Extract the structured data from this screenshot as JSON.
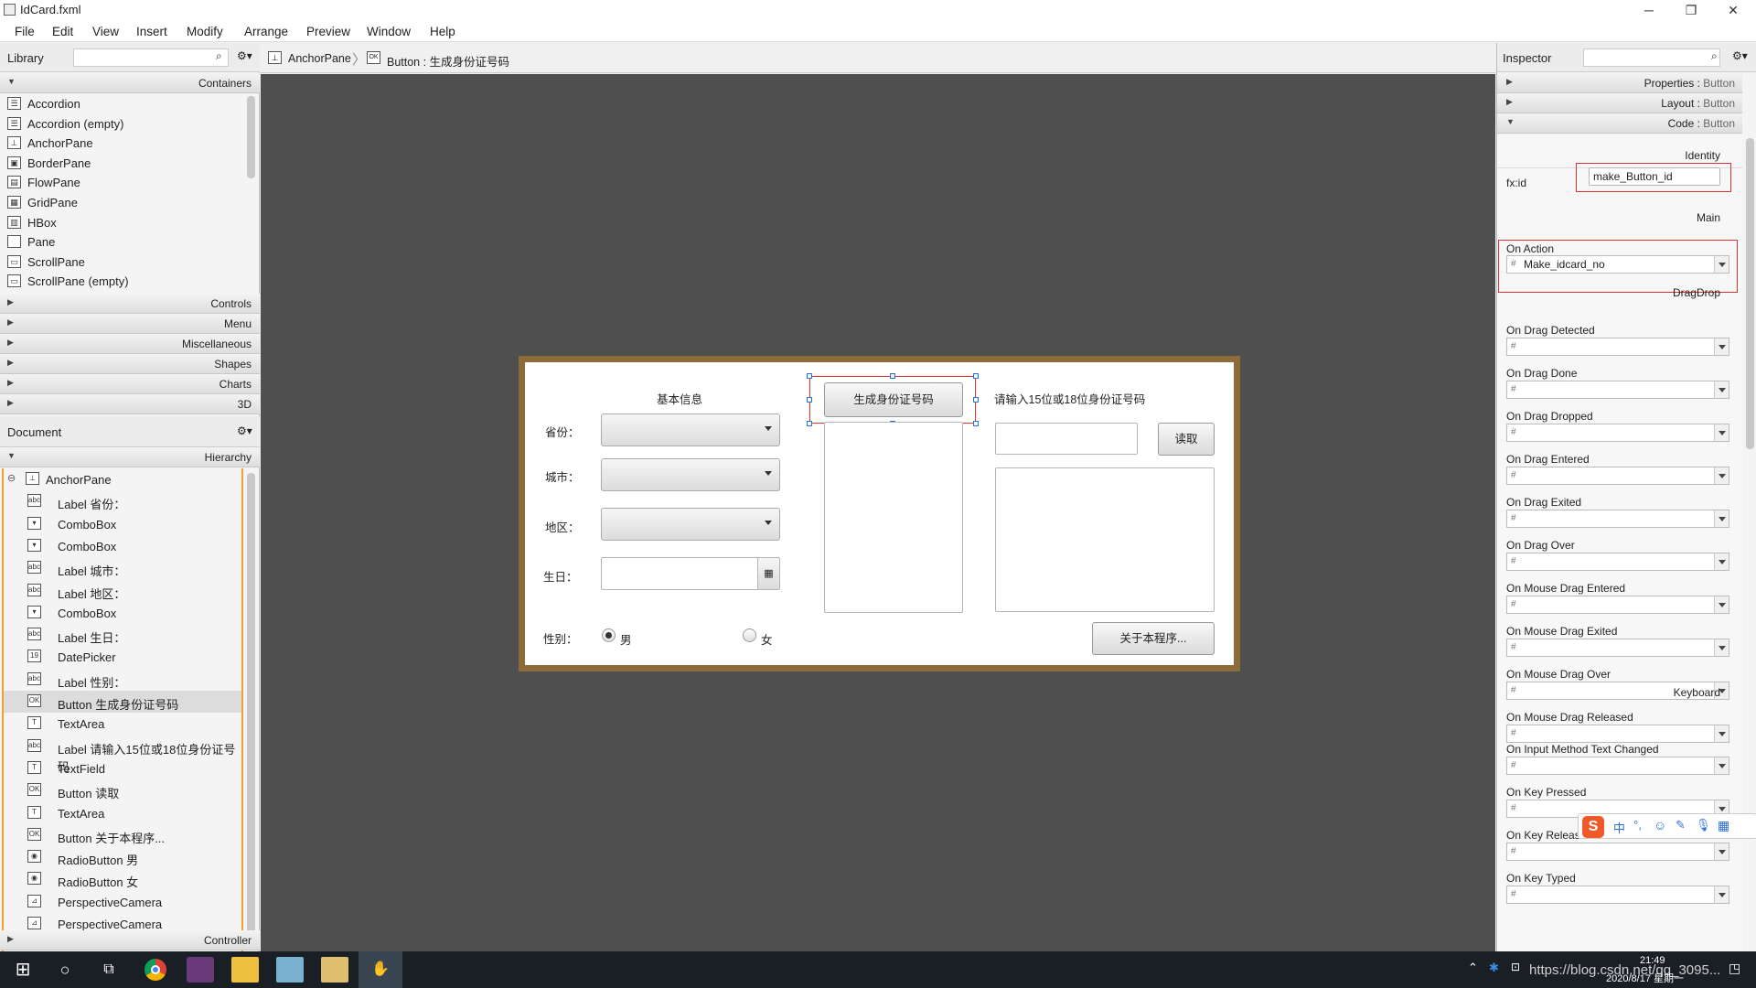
{
  "window": {
    "title": "IdCard.fxml"
  },
  "menu": [
    "File",
    "Edit",
    "View",
    "Insert",
    "Modify",
    "Arrange",
    "Preview",
    "Window",
    "Help"
  ],
  "library": {
    "title": "Library",
    "sections": {
      "containers": "Containers",
      "controls": "Controls",
      "menu": "Menu",
      "misc": "Miscellaneous",
      "shapes": "Shapes",
      "charts": "Charts",
      "three_d": "3D"
    },
    "items": [
      "Accordion",
      "Accordion  (empty)",
      "AnchorPane",
      "BorderPane",
      "FlowPane",
      "GridPane",
      "HBox",
      "Pane",
      "ScrollPane",
      "ScrollPane  (empty)"
    ]
  },
  "document": {
    "title": "Document",
    "hierarchy_label": "Hierarchy",
    "root": "AnchorPane",
    "items": [
      {
        "icon": "abc",
        "text": "Label  省份："
      },
      {
        "icon": "cb",
        "text": "ComboBox"
      },
      {
        "icon": "cb",
        "text": "ComboBox"
      },
      {
        "icon": "abc",
        "text": "Label  城市："
      },
      {
        "icon": "abc",
        "text": "Label  地区："
      },
      {
        "icon": "cb",
        "text": "ComboBox"
      },
      {
        "icon": "abc",
        "text": "Label  生日："
      },
      {
        "icon": "19",
        "text": "DatePicker"
      },
      {
        "icon": "abc",
        "text": "Label  性别："
      },
      {
        "icon": "OK",
        "text": "Button  生成身份证号码"
      },
      {
        "icon": "T",
        "text": "TextArea"
      },
      {
        "icon": "abc",
        "text": "Label  请输入15位或18位身份证号码"
      },
      {
        "icon": "T",
        "text": "TextField"
      },
      {
        "icon": "OK",
        "text": "Button  读取"
      },
      {
        "icon": "T",
        "text": "TextArea"
      },
      {
        "icon": "OK",
        "text": "Button  关于本程序..."
      },
      {
        "icon": "◉",
        "text": "RadioButton  男"
      },
      {
        "icon": "◉",
        "text": "RadioButton  女"
      },
      {
        "icon": "cam",
        "text": "PerspectiveCamera"
      },
      {
        "icon": "cam",
        "text": "PerspectiveCamera"
      }
    ],
    "controller_label": "Controller"
  },
  "breadcrumb": {
    "root": "AnchorPane",
    "current": "Button : 生成身份证号码"
  },
  "form": {
    "basic_info": "基本信息",
    "province": "省份：",
    "city": "城市：",
    "district": "地区：",
    "birthday": "生日：",
    "gender": "性别：",
    "male": "男",
    "female": "女",
    "generate_button": "生成身份证号码",
    "input_prompt": "请输入15位或18位身份证号码",
    "read_button": "读取",
    "about_button": "关于本程序..."
  },
  "inspector": {
    "title": "Inspector",
    "sections": {
      "properties": {
        "name": "Properties",
        "target": "Button"
      },
      "layout": {
        "name": "Layout",
        "target": "Button"
      },
      "code": {
        "name": "Code",
        "target": "Button"
      }
    },
    "identity_label": "Identity",
    "fxid_label": "fx:id",
    "fxid_value": "make_Button_id",
    "main_label": "Main",
    "on_action_label": "On Action",
    "on_action_value": "Make_idcard_no",
    "dragdrop_label": "DragDrop",
    "drag_events": [
      "On Drag Detected",
      "On Drag Done",
      "On Drag Dropped",
      "On Drag Entered",
      "On Drag Exited",
      "On Drag Over",
      "On Mouse Drag Entered",
      "On Mouse Drag Exited",
      "On Mouse Drag Over",
      "On Mouse Drag Released"
    ],
    "keyboard_label": "Keyboard",
    "key_events": [
      "On Input Method Text Changed",
      "On Key Pressed",
      "On Key Released",
      "On Key Typed"
    ],
    "hash": "#"
  },
  "taskbar": {
    "time": "21:49",
    "date": "2020/8/17 星期一",
    "watermark": "https://blog.csdn.net/qq_3095..."
  },
  "colors": {
    "canvas": "#4f4f4f",
    "stage_border": "#8c6d3a",
    "selection": "#e03030",
    "handle": "#2a6fd6"
  }
}
